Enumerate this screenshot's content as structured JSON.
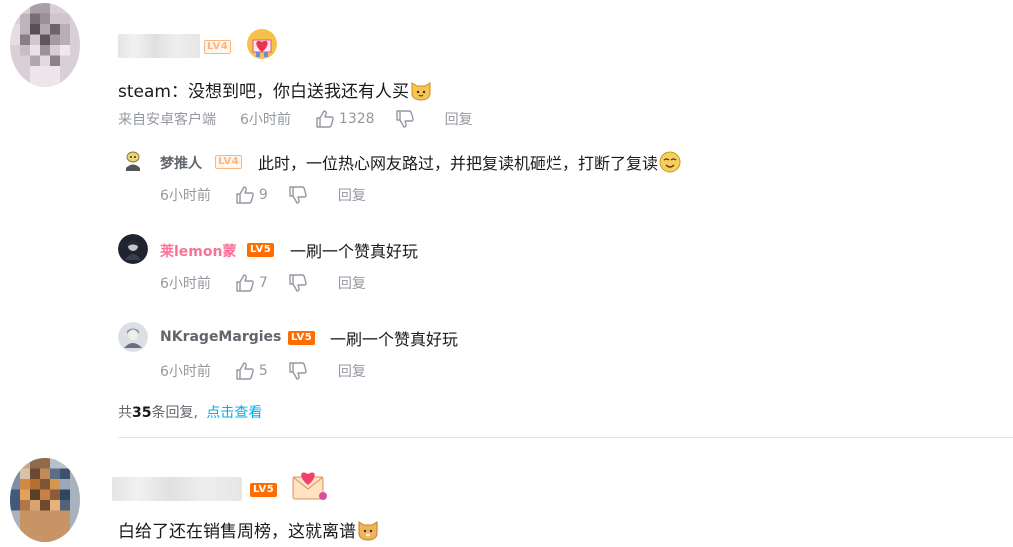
{
  "comments": [
    {
      "user_level": "LV4",
      "text": "steam：没想到吧，你白送我还有人买",
      "source": "来自安卓客户端",
      "time": "6小时前",
      "likes": "1328",
      "reply_label": "回复",
      "replies": [
        {
          "name": "梦推人",
          "level": "LV4",
          "text": "此时，一位热心网友路过，并把复读机砸烂，打断了复读",
          "time": "6小时前",
          "likes": "9",
          "reply_label": "回复"
        },
        {
          "name": "莱lemon蒙",
          "level": "LV5",
          "text": "一刷一个赞真好玩",
          "time": "6小时前",
          "likes": "7",
          "reply_label": "回复"
        },
        {
          "name": "NKrageMargies",
          "level": "LV5",
          "text": "一刷一个赞真好玩",
          "time": "6小时前",
          "likes": "5",
          "reply_label": "回复"
        }
      ],
      "more_prefix": "共",
      "more_count": "35",
      "more_suffix": "条回复,",
      "more_link": "点击查看"
    },
    {
      "user_level": "LV5",
      "text": "白给了还在销售周榜，这就离谱"
    }
  ],
  "colors": {
    "pink_name": "#fb7299",
    "link": "#00aeec",
    "meta": "#9499a0",
    "lv5": "#ff6c00",
    "lv4": "#ffb37c"
  }
}
